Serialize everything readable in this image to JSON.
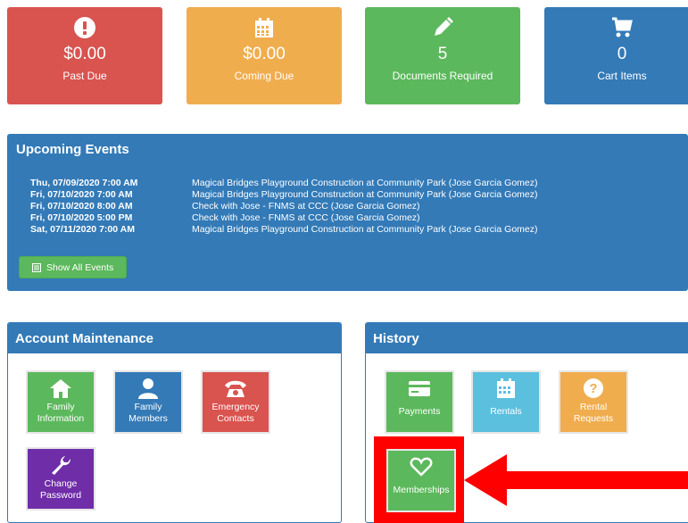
{
  "summary": {
    "past_due": {
      "value": "$0.00",
      "label": "Past Due",
      "icon": "exclamation-circle-icon",
      "color": "#d9534f"
    },
    "coming_due": {
      "value": "$0.00",
      "label": "Coming Due",
      "icon": "calendar-icon",
      "color": "#f0ad4e"
    },
    "documents": {
      "value": "5",
      "label": "Documents Required",
      "icon": "pencil-icon",
      "color": "#5cb85c"
    },
    "cart": {
      "value": "0",
      "label": "Cart Items",
      "icon": "cart-icon",
      "color": "#337ab7"
    }
  },
  "events": {
    "title": "Upcoming Events",
    "items": [
      {
        "date": "Thu, 07/09/2020 7:00 AM",
        "text": "Magical Bridges Playground Construction at Community Park (Jose Garcia Gomez)"
      },
      {
        "date": "Fri, 07/10/2020 7:00 AM",
        "text": "Magical Bridges Playground Construction at Community Park (Jose Garcia Gomez)"
      },
      {
        "date": "Fri, 07/10/2020 8:00 AM",
        "text": "Check with Jose - FNMS at CCC (Jose Garcia Gomez)"
      },
      {
        "date": "Fri, 07/10/2020 5:00 PM",
        "text": "Check with Jose - FNMS at CCC (Jose Garcia Gomez)"
      },
      {
        "date": "Sat, 07/11/2020 7:00 AM",
        "text": "Magical Bridges Playground Construction at Community Park (Jose Garcia Gomez)"
      }
    ],
    "button": "Show All Events"
  },
  "account": {
    "title": "Account Maintenance",
    "items": [
      {
        "line1": "Family",
        "line2": "Information",
        "icon": "home-icon",
        "color": "#5cb85c"
      },
      {
        "line1": "Family",
        "line2": "Members",
        "icon": "user-icon",
        "color": "#337ab7"
      },
      {
        "line1": "Emergency",
        "line2": "Contacts",
        "icon": "phone-icon",
        "color": "#d9534f"
      },
      {
        "line1": "Change",
        "line2": "Password",
        "icon": "wrench-icon",
        "color": "#6f2da8"
      }
    ]
  },
  "history": {
    "title": "History",
    "items": [
      {
        "line1": "Payments",
        "line2": "",
        "icon": "credit-card-icon",
        "color": "#5cb85c"
      },
      {
        "line1": "Rentals",
        "line2": "",
        "icon": "calendar-icon",
        "color": "#5bc0de"
      },
      {
        "line1": "Rental",
        "line2": "Requests",
        "icon": "question-circle-icon",
        "color": "#f0ad4e"
      },
      {
        "line1": "Memberships",
        "line2": "",
        "icon": "heart-icon",
        "color": "#5cb85c"
      }
    ]
  },
  "annotation": {
    "highlight_color": "#ff0000"
  }
}
